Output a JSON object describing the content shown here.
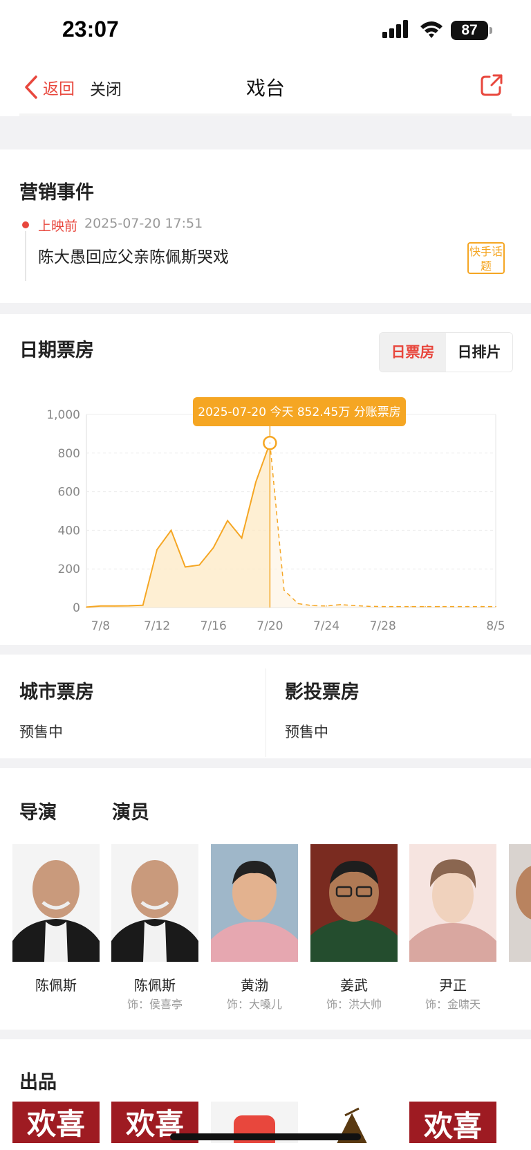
{
  "status_bar": {
    "time": "23:07",
    "battery": "87"
  },
  "nav": {
    "back_label": "返回",
    "close_label": "关闭",
    "title": "戏台"
  },
  "marketing": {
    "title": "营销事件",
    "events": [
      {
        "tag": "上映前",
        "datetime": "2025-07-20 17:51",
        "text": "陈大愚回应父亲陈佩斯哭戏",
        "badge": "快手话题"
      }
    ]
  },
  "daily_box_office": {
    "title": "日期票房",
    "tabs": [
      "日票房",
      "日排片"
    ],
    "active_tab": "日票房",
    "tooltip": "2025-07-20 今天 852.45万 分账票房"
  },
  "chart_data": {
    "type": "area",
    "x": [
      "7/7",
      "7/8",
      "7/9",
      "7/10",
      "7/11",
      "7/12",
      "7/13",
      "7/14",
      "7/15",
      "7/16",
      "7/17",
      "7/18",
      "7/19",
      "7/20",
      "7/21",
      "7/22",
      "7/23",
      "7/24",
      "7/25",
      "7/26",
      "7/27",
      "7/28",
      "7/29",
      "7/30",
      "7/31",
      "8/1",
      "8/2",
      "8/3",
      "8/4",
      "8/5"
    ],
    "values": [
      2,
      8,
      8,
      9,
      12,
      300,
      400,
      210,
      220,
      310,
      450,
      360,
      650,
      852.45,
      90,
      20,
      10,
      8,
      15,
      10,
      6,
      5,
      5,
      5,
      5,
      5,
      5,
      5,
      5,
      5
    ],
    "actual_until": "7/20",
    "x_ticks": [
      "7/8",
      "7/12",
      "7/16",
      "7/20",
      "7/24",
      "7/28",
      "8/5"
    ],
    "y_ticks": [
      "0",
      "200",
      "400",
      "600",
      "800",
      "1,000"
    ],
    "ylim": [
      0,
      1000
    ],
    "highlight": {
      "x": "7/20",
      "value": 852.45
    },
    "colors": {
      "line": "#f5a623",
      "fill": "#fde9c4",
      "tooltip": "#f5a623"
    }
  },
  "city_box_office": {
    "title": "城市票房",
    "value": "预售中"
  },
  "investor_box_office": {
    "title": "影投票房",
    "value": "预售中"
  },
  "cast": {
    "tabs": [
      "导演",
      "演员"
    ],
    "people": [
      {
        "name": "陈佩斯",
        "role": ""
      },
      {
        "name": "陈佩斯",
        "role": "饰：侯喜亭"
      },
      {
        "name": "黄渤",
        "role": "饰：大嗓儿"
      },
      {
        "name": "姜武",
        "role": "饰：洪大帅"
      },
      {
        "name": "尹正",
        "role": "饰：金啸天"
      }
    ]
  },
  "producers": {
    "title": "出品",
    "logos": [
      "欢喜",
      "欢喜",
      "",
      "",
      "欢喜"
    ]
  },
  "colors": {
    "accent": "#e8473d",
    "orange": "#f5a623"
  }
}
